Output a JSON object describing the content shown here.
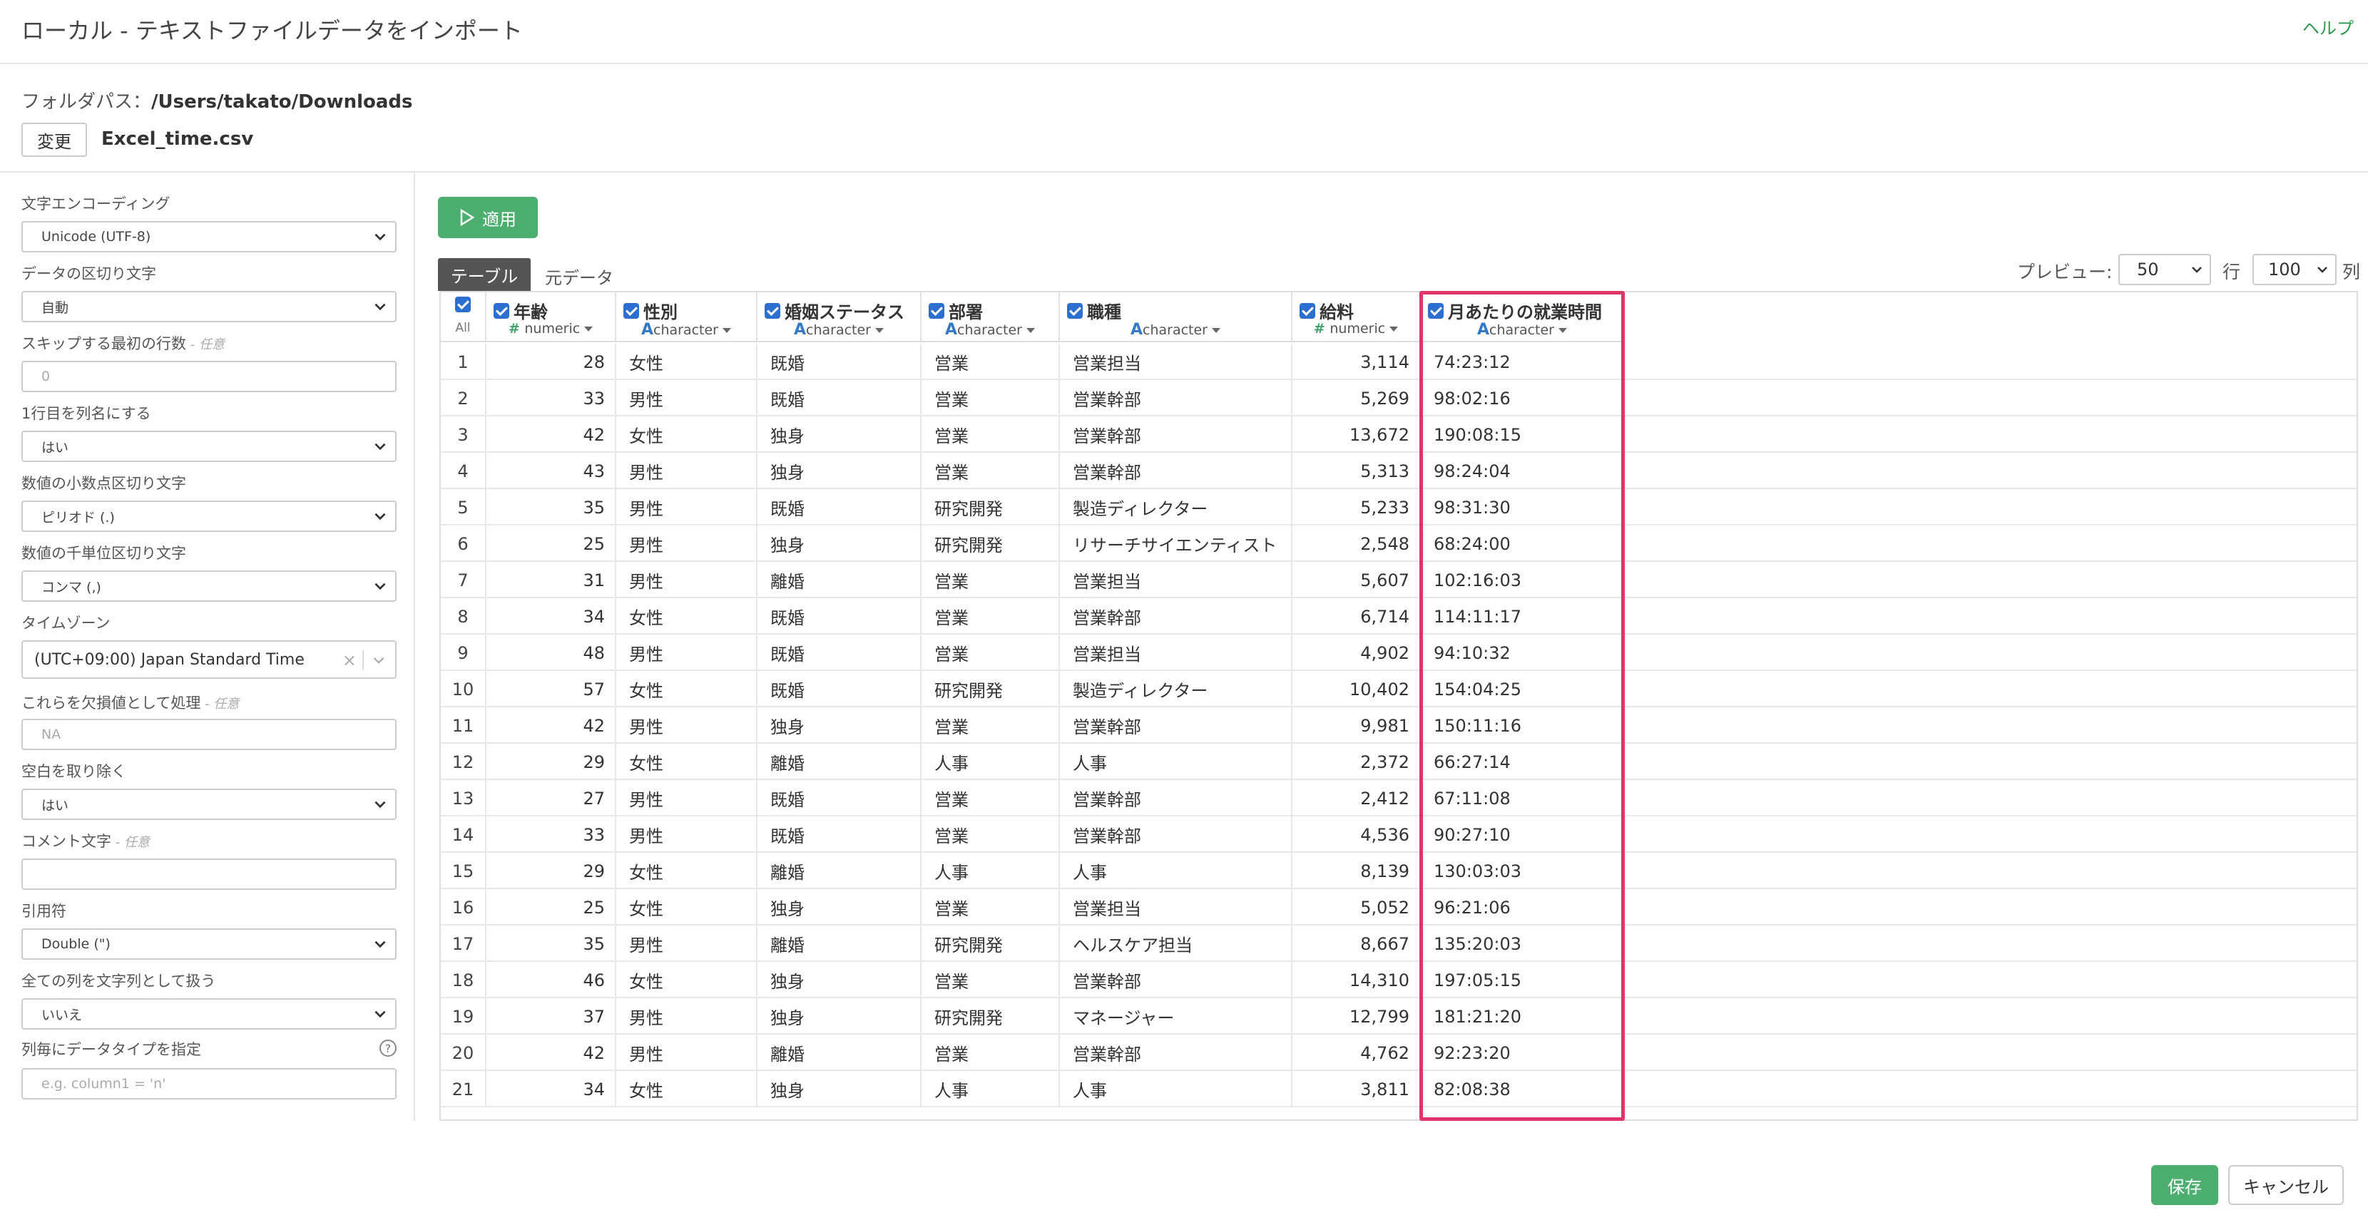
{
  "window": {
    "title": "ローカル - テキストファイルデータをインポート",
    "help_link": "ヘルプ"
  },
  "folder": {
    "label": "フォルダパス：",
    "path": "/Users/takato/Downloads",
    "change_button": "変更",
    "filename": "Excel_time.csv"
  },
  "settings": {
    "encoding": {
      "label": "文字エンコーディング",
      "value": "Unicode (UTF-8)"
    },
    "delimiter": {
      "label": "データの区切り文字",
      "value": "自動"
    },
    "skip_rows": {
      "label": "スキップする最初の行数",
      "optional": " - 任意",
      "placeholder": "0"
    },
    "header_row": {
      "label": "1行目を列名にする",
      "value": "はい"
    },
    "decimal_sep": {
      "label": "数値の小数点区切り文字",
      "value": "ピリオド (.)"
    },
    "thousands_sep": {
      "label": "数値の千単位区切り文字",
      "value": "コンマ (,)"
    },
    "timezone": {
      "label": "タイムゾーン",
      "value": "(UTC+09:00) Japan Standard Time"
    },
    "na_values": {
      "label": "これらを欠損値として処理",
      "optional": " - 任意",
      "placeholder": "NA"
    },
    "trim_ws": {
      "label": "空白を取り除く",
      "value": "はい"
    },
    "comment": {
      "label": "コメント文字",
      "optional": " - 任意",
      "placeholder": ""
    },
    "quote": {
      "label": "引用符",
      "value": "Double (\")"
    },
    "all_char": {
      "label": "全ての列を文字列として扱う",
      "value": "いいえ"
    },
    "col_types": {
      "label": "列毎にデータタイプを指定",
      "placeholder": "e.g. column1 = 'n'"
    }
  },
  "apply_button": "適用",
  "tabs": {
    "table": "テーブル",
    "raw": "元データ"
  },
  "preview": {
    "label": "プレビュー:",
    "rows_value": "50",
    "rows_label": "行",
    "cols_value": "100",
    "cols_label": "列"
  },
  "grid": {
    "all_label": "All",
    "columns": [
      {
        "name": "年齢",
        "type": "numeric",
        "kind": "num"
      },
      {
        "name": "性別",
        "type": "character",
        "kind": "chr"
      },
      {
        "name": "婚姻ステータス",
        "type": "character",
        "kind": "chr"
      },
      {
        "name": "部署",
        "type": "character",
        "kind": "chr"
      },
      {
        "name": "職種",
        "type": "character",
        "kind": "chr"
      },
      {
        "name": "給料",
        "type": "numeric",
        "kind": "num"
      },
      {
        "name": "月あたりの就業時間",
        "type": "character",
        "kind": "chr"
      }
    ],
    "rows": [
      [
        "1",
        "28",
        "女性",
        "既婚",
        "営業",
        "営業担当",
        "3,114",
        "74:23:12"
      ],
      [
        "2",
        "33",
        "男性",
        "既婚",
        "営業",
        "営業幹部",
        "5,269",
        "98:02:16"
      ],
      [
        "3",
        "42",
        "女性",
        "独身",
        "営業",
        "営業幹部",
        "13,672",
        "190:08:15"
      ],
      [
        "4",
        "43",
        "男性",
        "独身",
        "営業",
        "営業幹部",
        "5,313",
        "98:24:04"
      ],
      [
        "5",
        "35",
        "男性",
        "既婚",
        "研究開発",
        "製造ディレクター",
        "5,233",
        "98:31:30"
      ],
      [
        "6",
        "25",
        "男性",
        "独身",
        "研究開発",
        "リサーチサイエンティスト",
        "2,548",
        "68:24:00"
      ],
      [
        "7",
        "31",
        "男性",
        "離婚",
        "営業",
        "営業担当",
        "5,607",
        "102:16:03"
      ],
      [
        "8",
        "34",
        "女性",
        "既婚",
        "営業",
        "営業幹部",
        "6,714",
        "114:11:17"
      ],
      [
        "9",
        "48",
        "男性",
        "既婚",
        "営業",
        "営業担当",
        "4,902",
        "94:10:32"
      ],
      [
        "10",
        "57",
        "女性",
        "既婚",
        "研究開発",
        "製造ディレクター",
        "10,402",
        "154:04:25"
      ],
      [
        "11",
        "42",
        "男性",
        "独身",
        "営業",
        "営業幹部",
        "9,981",
        "150:11:16"
      ],
      [
        "12",
        "29",
        "女性",
        "離婚",
        "人事",
        "人事",
        "2,372",
        "66:27:14"
      ],
      [
        "13",
        "27",
        "男性",
        "既婚",
        "営業",
        "営業幹部",
        "2,412",
        "67:11:08"
      ],
      [
        "14",
        "33",
        "男性",
        "既婚",
        "営業",
        "営業幹部",
        "4,536",
        "90:27:10"
      ],
      [
        "15",
        "29",
        "女性",
        "離婚",
        "人事",
        "人事",
        "8,139",
        "130:03:03"
      ],
      [
        "16",
        "25",
        "女性",
        "独身",
        "営業",
        "営業担当",
        "5,052",
        "96:21:06"
      ],
      [
        "17",
        "35",
        "男性",
        "離婚",
        "研究開発",
        "ヘルスケア担当",
        "8,667",
        "135:20:03"
      ],
      [
        "18",
        "46",
        "女性",
        "独身",
        "営業",
        "営業幹部",
        "14,310",
        "197:05:15"
      ],
      [
        "19",
        "37",
        "男性",
        "独身",
        "研究開発",
        "マネージャー",
        "12,799",
        "181:21:20"
      ],
      [
        "20",
        "42",
        "男性",
        "離婚",
        "営業",
        "営業幹部",
        "4,762",
        "92:23:20"
      ],
      [
        "21",
        "34",
        "女性",
        "独身",
        "人事",
        "人事",
        "3,811",
        "82:08:38"
      ]
    ]
  },
  "footer": {
    "save": "保存",
    "cancel": "キャンセル"
  }
}
